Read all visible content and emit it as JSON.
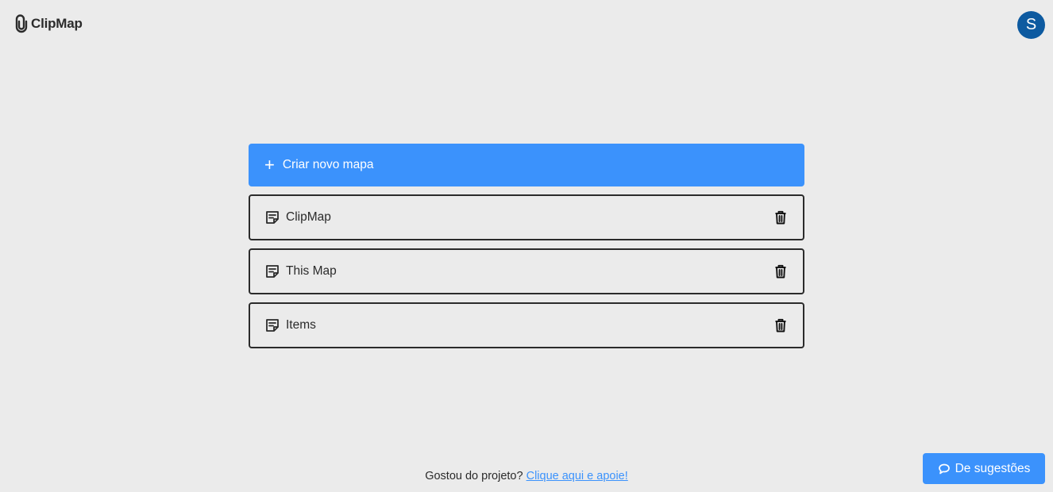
{
  "app": {
    "name": "ClipMap",
    "icon": "paperclip-icon"
  },
  "user": {
    "initial": "S",
    "avatar_color": "#0d5aa0"
  },
  "create": {
    "icon": "plus-icon",
    "label": "Criar novo mapa",
    "color": "#3b92fc"
  },
  "maps": [
    {
      "name": "ClipMap",
      "icon": "note-icon",
      "action_icon": "trash-icon"
    },
    {
      "name": "This Map",
      "icon": "note-icon",
      "action_icon": "trash-icon"
    },
    {
      "name": "Items",
      "icon": "note-icon",
      "action_icon": "trash-icon"
    }
  ],
  "footer": {
    "text": "Gostou do projeto?",
    "link_text": "Clique aqui e apoie!"
  },
  "suggest": {
    "icon": "chat-bubble-icon",
    "label": "De sugestões"
  },
  "colors": {
    "background": "#ebebeb",
    "accent": "#3b92fc",
    "text": "#2b2b2b"
  }
}
